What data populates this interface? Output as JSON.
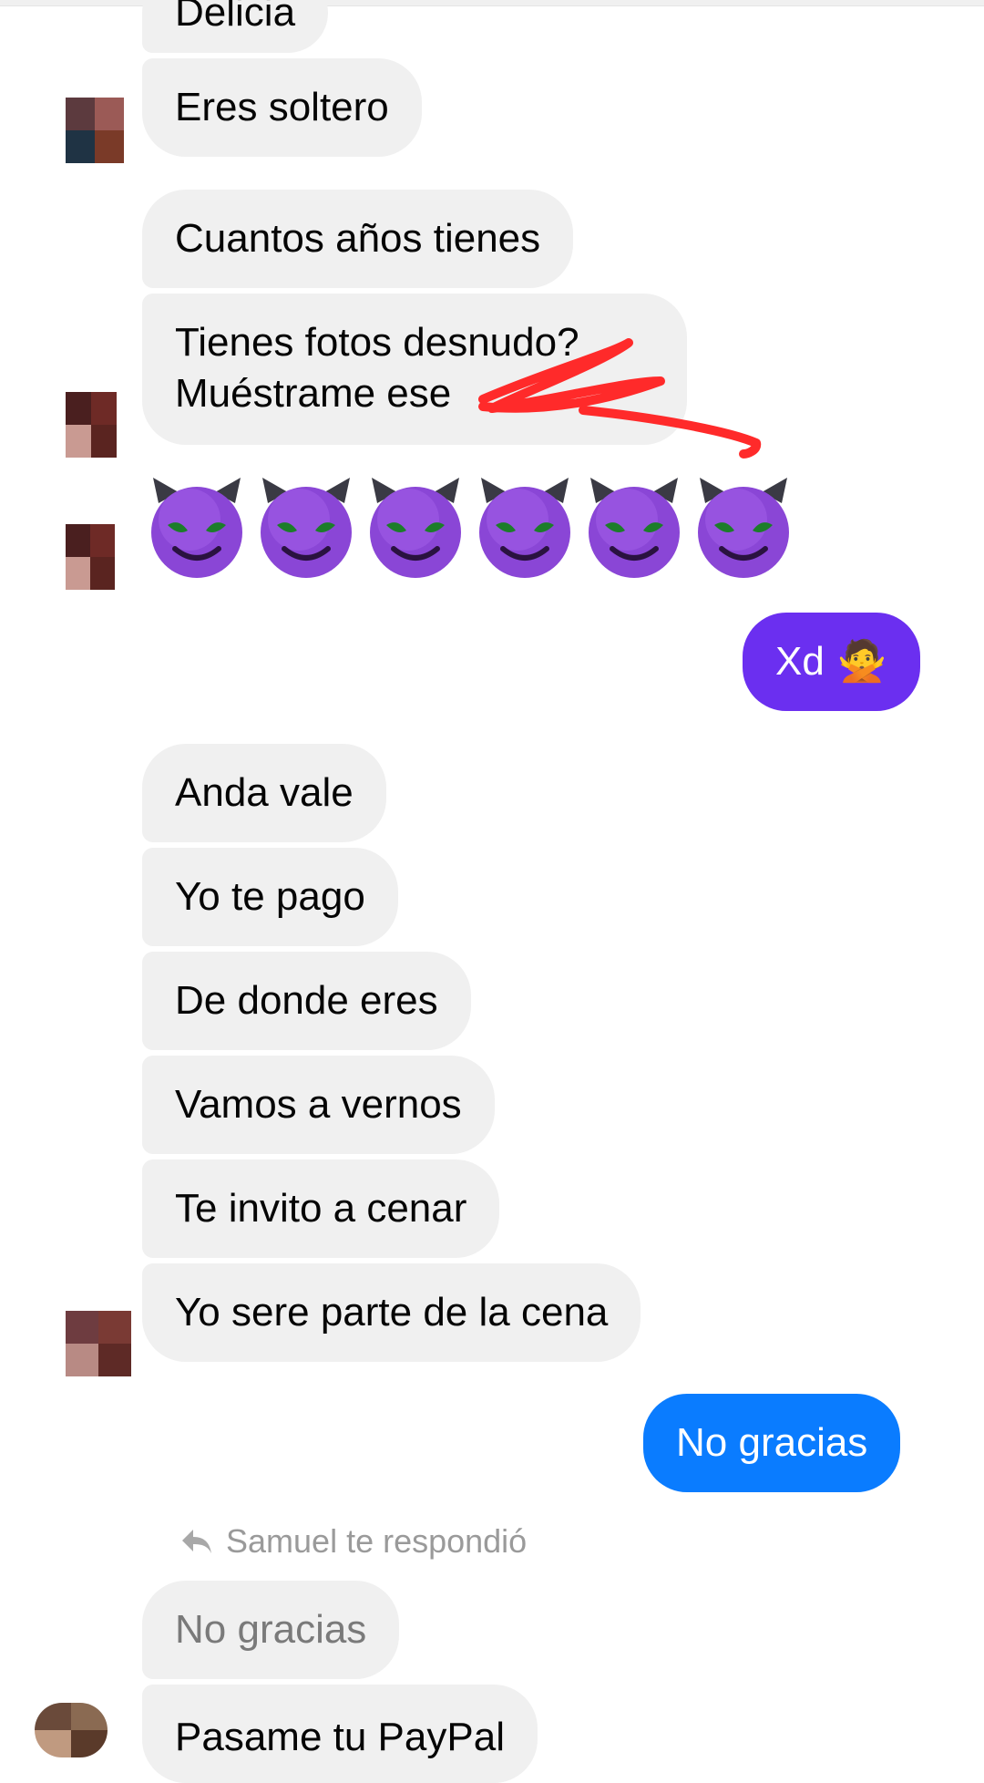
{
  "messages": {
    "m0": "Delicia",
    "m1": "Eres soltero",
    "m2": "Cuantos años tienes",
    "m3_line1": "Tienes fotos desnudo?",
    "m3_line2": "Muéstrame ese",
    "m4": "Anda vale",
    "m5": "Yo te pago",
    "m6": "De donde eres",
    "m7": "Vamos a vernos",
    "m8": "Te invito a cenar",
    "m9": "Yo sere parte de la cena",
    "m10": "No gracias",
    "m11": "Pasame tu PayPal"
  },
  "outgoing": {
    "xd": "Xd",
    "xd_emoji": "🙅",
    "no_gracias": "No gracias"
  },
  "reply_note": "Samuel te respondió",
  "colors": {
    "incoming_bubble": "#f0f0f0",
    "outgoing_purple": "#6b2ff0",
    "outgoing_blue": "#0a7cff",
    "scribble_red": "#ff2a2a"
  },
  "icons": {
    "emoji": "smiling-face-with-horns",
    "reply": "reply-arrow-icon"
  }
}
